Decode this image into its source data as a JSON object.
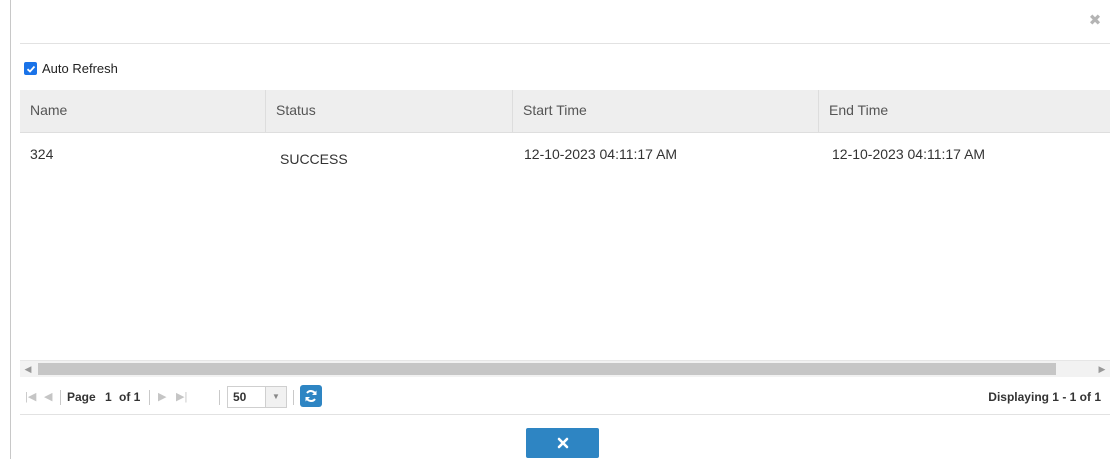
{
  "dialog": {
    "close_icon": "close-icon",
    "auto_refresh": {
      "label": "Auto Refresh",
      "checked": true,
      "accent": "#1a73e8"
    }
  },
  "grid": {
    "columns": [
      "Name",
      "Status",
      "Start Time",
      "End Time"
    ],
    "rows": [
      {
        "name": "324",
        "status": "SUCCESS",
        "start_time": "12-10-2023 04:11:17 AM",
        "end_time": "12-10-2023 04:11:17 AM"
      }
    ]
  },
  "pager": {
    "page_label": "Page",
    "page_value": "1",
    "of_label": "of 1",
    "page_size": "50",
    "displaying": "Displaying 1 - 1 of 1",
    "icons": [
      "first-page-icon",
      "prev-page-icon",
      "next-page-icon",
      "last-page-icon",
      "refresh-icon"
    ]
  },
  "footer": {
    "close_button_icon": "close-icon",
    "accent": "#2e85c3"
  }
}
